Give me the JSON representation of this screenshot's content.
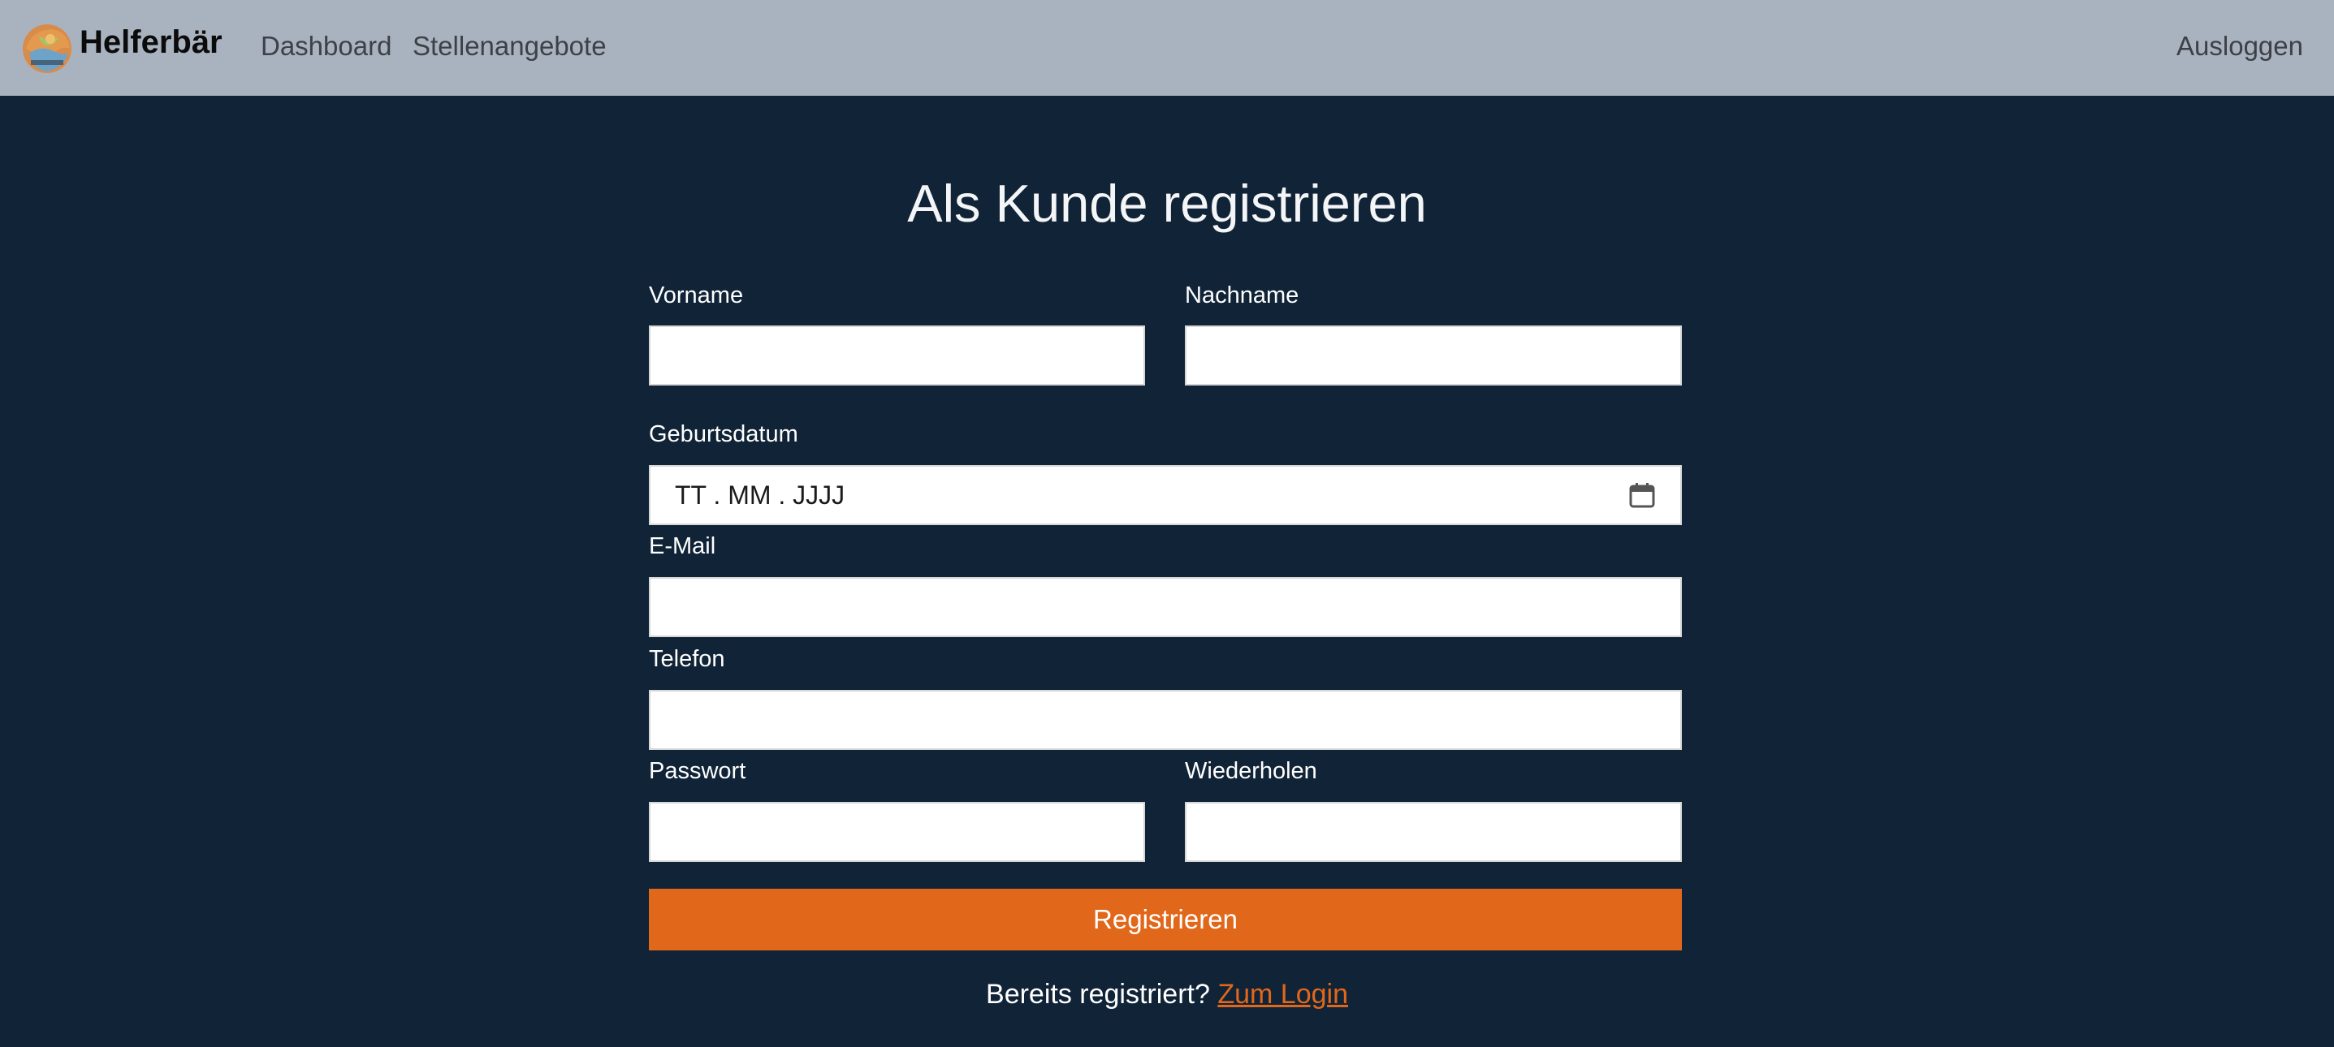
{
  "navbar": {
    "brand_name": "Helferbär",
    "logo_icon": "bear-logo-icon",
    "links": {
      "dashboard": "Dashboard",
      "jobs": "Stellenangebote",
      "logout": "Ausloggen"
    }
  },
  "form": {
    "title": "Als Kunde registrieren",
    "first_name": {
      "label": "Vorname",
      "value": ""
    },
    "last_name": {
      "label": "Nachname",
      "value": ""
    },
    "birthdate": {
      "label": "Geburtsdatum",
      "placeholder": "TT . MM . JJJJ",
      "icon": "calendar-icon"
    },
    "email": {
      "label": "E-Mail",
      "value": ""
    },
    "phone": {
      "label": "Telefon",
      "value": ""
    },
    "password": {
      "label": "Passwort",
      "value": ""
    },
    "password_repeat": {
      "label": "Wiederholen",
      "value": ""
    },
    "submit_label": "Registrieren",
    "already_text": "Bereits registriert?",
    "login_link": "Zum Login"
  },
  "colors": {
    "background": "#102337",
    "navbar": "#a9b3bf",
    "accent": "#e1681a"
  }
}
